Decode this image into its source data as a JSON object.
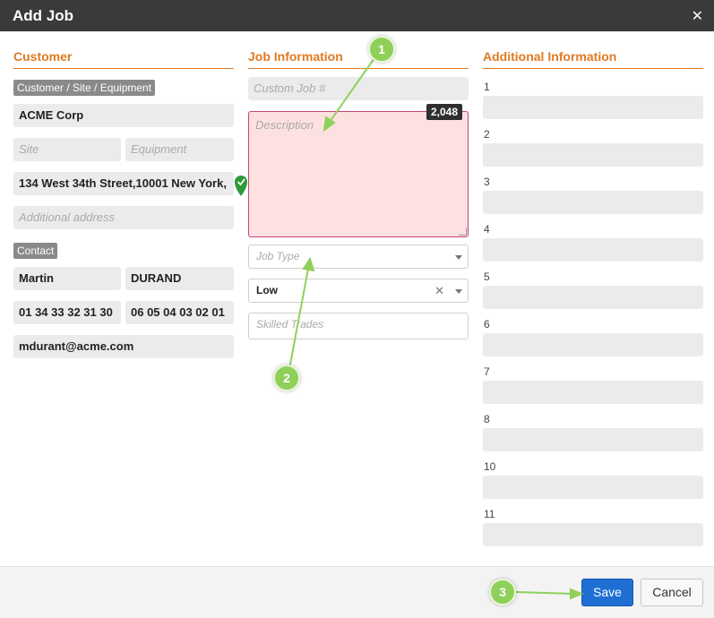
{
  "dialog": {
    "title": "Add Job",
    "close_icon": "close-icon"
  },
  "customer": {
    "header": "Customer",
    "tag": "Customer / Site / Equipment",
    "customer_name": "ACME Corp",
    "site_placeholder": "Site",
    "equipment_placeholder": "Equipment",
    "address": "134 West 34th Street,10001 New York,",
    "address_status_icon": "geo-verified-icon",
    "additional_address_placeholder": "Additional address",
    "contact_tag": "Contact",
    "first_name": "Martin",
    "last_name": "DURAND",
    "phone": "01 34 33 32 31 30",
    "mobile": "06 05 04 03 02 01",
    "email": "mdurant@acme.com"
  },
  "job": {
    "header": "Job Information",
    "custom_job_placeholder": "Custom Job #",
    "description_placeholder": "Description",
    "char_counter": "2,048",
    "job_type_placeholder": "Job Type",
    "priority_value": "Low",
    "skilled_trades_placeholder": "Skilled Trades"
  },
  "additional": {
    "header": "Additional Information",
    "fields": [
      {
        "label": "1"
      },
      {
        "label": "2"
      },
      {
        "label": "3"
      },
      {
        "label": "4"
      },
      {
        "label": "5"
      },
      {
        "label": "6"
      },
      {
        "label": "7"
      },
      {
        "label": "8"
      },
      {
        "label": "10"
      },
      {
        "label": "11"
      }
    ]
  },
  "footer": {
    "save_label": "Save",
    "cancel_label": "Cancel"
  },
  "annotations": {
    "marker_1": "1",
    "marker_2": "2",
    "marker_3": "3"
  },
  "colors": {
    "accent": "#e07b22",
    "primary": "#1f6ed4",
    "marker": "#8fd05a",
    "error_bg": "#fde0e0"
  }
}
